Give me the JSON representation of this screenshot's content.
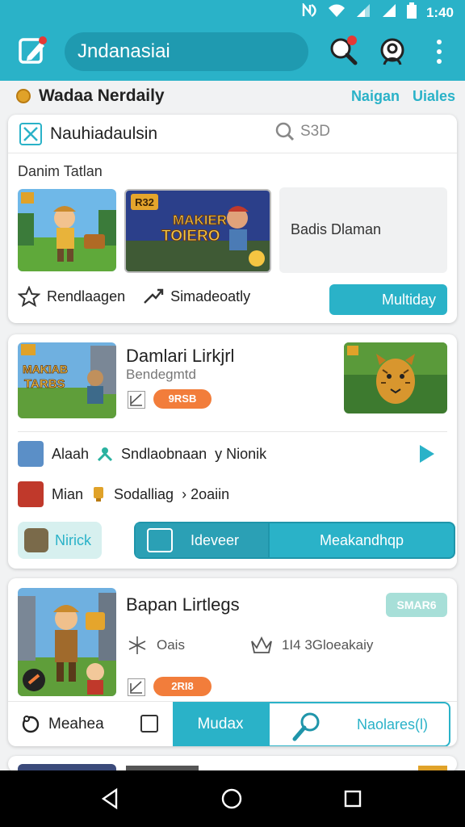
{
  "status_bar": {
    "time": "1:40"
  },
  "app_bar": {
    "search_text": "Jndanasiai"
  },
  "section": {
    "title": "Wadaa  Nerdaily",
    "link1": "Naigan",
    "link2": "Uiales"
  },
  "card1": {
    "header": "Nauhiadaulsin",
    "search_label": "S3D",
    "subtitle": "Danim Tatlan",
    "thumb2_text_top": "MAKIER",
    "thumb2_text_bottom": "TOIERO",
    "thumb2_badge": "R32",
    "placeholder": "Badis Dlaman",
    "action1": "Rendlaagen",
    "action2": "Simadeoatly",
    "button": "Multiday"
  },
  "card2": {
    "title": "Damlari Lirkjrl",
    "subtitle": "Bendegmtd",
    "pill": "9RSB",
    "thumb1_text_top": "MAKIAB",
    "thumb1_text_bottom": "TARBS",
    "row1": {
      "name": "Alaah",
      "mid": "Sndlaobnaan",
      "right": "y  Nionik"
    },
    "row2": {
      "name": "Mian",
      "mid": "Sodalliag",
      "right": "› 2oaiin"
    },
    "nick": "Nirick",
    "seg1": "Ideveer",
    "seg2": "Meakandhqp"
  },
  "card3": {
    "title": "Bapan Lirtlegs",
    "badge": "SMAR6",
    "stat1": "Oais",
    "stat2": "1I4 3Gloeakaiy",
    "pill": "2RI8",
    "bar_left": "Meahea",
    "bar_active": "Mudax",
    "bar_right": "Naolares(l)"
  },
  "colors": {
    "accent": "#2ab2c8",
    "orange": "#f27d3b"
  }
}
